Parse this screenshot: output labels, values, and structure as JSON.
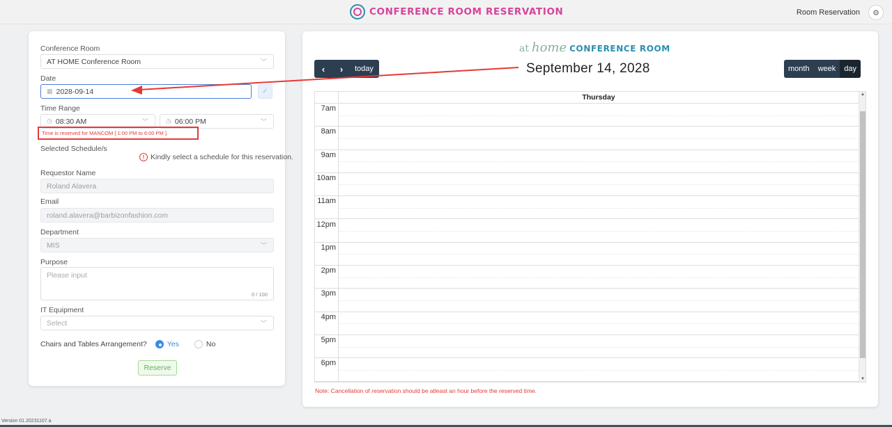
{
  "header": {
    "title": "CONFERENCE ROOM RESERVATION",
    "nav_link": "Room Reservation",
    "settings_icon": "gear-icon"
  },
  "form": {
    "conference_room_label": "Conference Room",
    "conference_room_value": "AT HOME Conference Room",
    "date_label": "Date",
    "date_value": "2028-09-14",
    "time_range_label": "Time Range",
    "time_start": "08:30 AM",
    "time_end": "06:00 PM",
    "time_error": "Time is reserved for MANCOM [ 1:00 PM to 6:00 PM ].",
    "schedule_label": "Selected Schedule/s",
    "schedule_warning": "Kindly select a schedule for this reservation.",
    "requestor_label": "Requestor Name",
    "requestor_value": "Roland Alavera",
    "email_label": "Email",
    "email_value": "roland.alavera@barbizonfashion.com",
    "department_label": "Department",
    "department_value": "MIS",
    "purpose_label": "Purpose",
    "purpose_placeholder": "Please input",
    "purpose_counter": "0 / 100",
    "it_label": "IT Equipment",
    "it_placeholder": "Select",
    "chairs_label": "Chairs and Tables Arrangement?",
    "chairs_yes": "Yes",
    "chairs_no": "No",
    "chairs_selected": "Yes",
    "reserve_label": "Reserve"
  },
  "calendar": {
    "title_at": "at",
    "title_home": "home",
    "title_room": "CONFERENCE ROOM",
    "prev_label": "‹",
    "next_label": "›",
    "today_label": "today",
    "current_date": "September 14, 2028",
    "views": [
      "month",
      "week",
      "day"
    ],
    "active_view": "day",
    "day_header": "Thursday",
    "time_slots": [
      "7am",
      "8am",
      "9am",
      "10am",
      "11am",
      "12pm",
      "1pm",
      "2pm",
      "3pm",
      "4pm",
      "5pm",
      "6pm"
    ],
    "note": "Note: Cancellation of reservation should be atleast an hour before the reserved time."
  },
  "footer": {
    "version": "Version 01.20231107.a"
  },
  "colors": {
    "brand_pink": "#d9439a",
    "brand_teal": "#2a8fb0",
    "toolbar_dark": "#2c3e50",
    "error_red": "#e53935",
    "reserve_green": "#5cb85c"
  }
}
